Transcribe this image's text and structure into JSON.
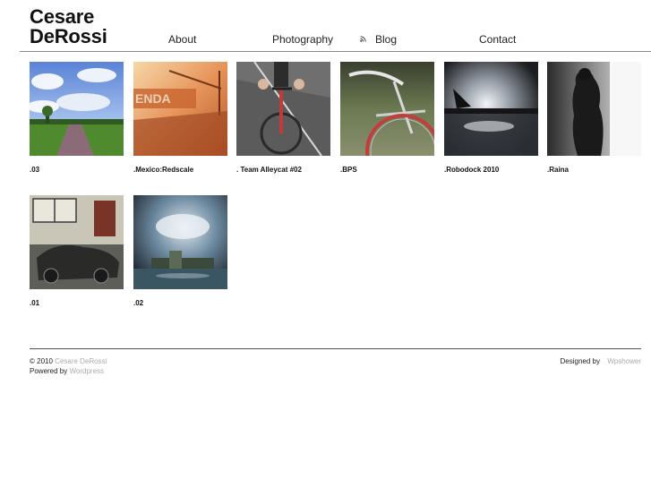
{
  "site": {
    "title_line1": "Cesare",
    "title_line2": "DeRossi"
  },
  "nav": {
    "items": [
      {
        "label": "About"
      },
      {
        "label": "Photography"
      },
      {
        "label": "Blog",
        "icon": "rss-icon"
      },
      {
        "label": "Contact"
      }
    ]
  },
  "gallery": {
    "items": [
      {
        "caption": ".03"
      },
      {
        "caption": ".Mexico:Redscale"
      },
      {
        "caption": ". Team Alleycat #02"
      },
      {
        "caption": ".BPS"
      },
      {
        "caption": ".Robodock 2010"
      },
      {
        "caption": ".Raina"
      },
      {
        "caption": ".01"
      },
      {
        "caption": ".02"
      }
    ]
  },
  "footer": {
    "copyright": "© 2010",
    "author_link": "Cesare DeRossi",
    "powered_by": "Powered by",
    "powered_link": "Wordpress",
    "designed_by": "Designed by",
    "designer_link": "Wpshower"
  }
}
